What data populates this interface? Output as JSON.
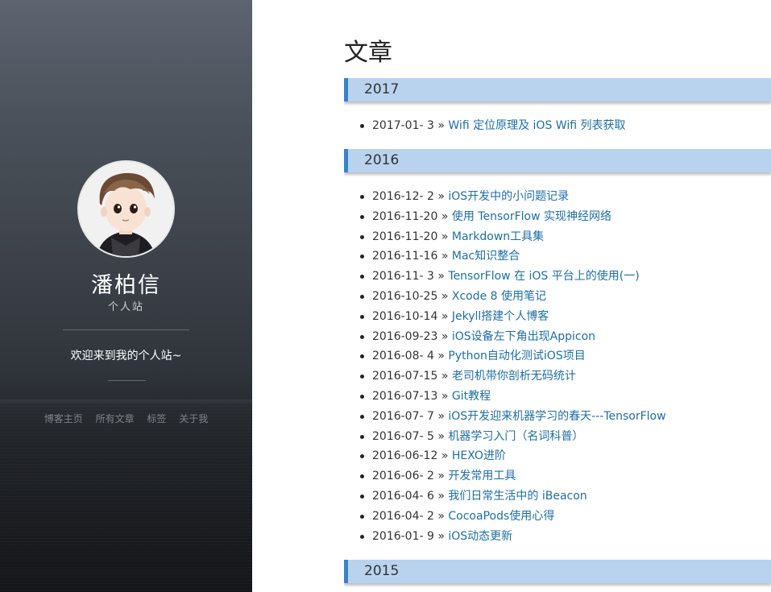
{
  "sidebar": {
    "name": "潘柏信",
    "subtitle": "个人站",
    "welcome": "欢迎来到我的个人站~",
    "nav": [
      "博客主页",
      "所有文章",
      "标签",
      "关于我"
    ]
  },
  "main": {
    "title": "文章",
    "separator": "»",
    "groups": [
      {
        "year": "2017",
        "posts": [
          {
            "date": "2017-01- 3",
            "title": "Wifi 定位原理及 iOS Wifi 列表获取"
          }
        ]
      },
      {
        "year": "2016",
        "posts": [
          {
            "date": "2016-12- 2",
            "title": "iOS开发中的小问题记录"
          },
          {
            "date": "2016-11-20",
            "title": "使用 TensorFlow 实现神经网络"
          },
          {
            "date": "2016-11-20",
            "title": "Markdown工具集"
          },
          {
            "date": "2016-11-16",
            "title": "Mac知识整合"
          },
          {
            "date": "2016-11- 3",
            "title": "TensorFlow 在 iOS 平台上的使用(一)"
          },
          {
            "date": "2016-10-25",
            "title": "Xcode 8 使用笔记"
          },
          {
            "date": "2016-10-14",
            "title": "Jekyll搭建个人博客"
          },
          {
            "date": "2016-09-23",
            "title": "iOS设备左下角出现Appicon"
          },
          {
            "date": "2016-08- 4",
            "title": "Python自动化测试iOS项目"
          },
          {
            "date": "2016-07-15",
            "title": "老司机带你剖析无码统计"
          },
          {
            "date": "2016-07-13",
            "title": "Git教程"
          },
          {
            "date": "2016-07- 7",
            "title": "iOS开发迎来机器学习的春天---TensorFlow"
          },
          {
            "date": "2016-07- 5",
            "title": "机器学习入门（名词科普）"
          },
          {
            "date": "2016-06-12",
            "title": "HEXO进阶"
          },
          {
            "date": "2016-06- 2",
            "title": "开发常用工具"
          },
          {
            "date": "2016-04- 6",
            "title": "我们日常生活中的 iBeacon"
          },
          {
            "date": "2016-04- 2",
            "title": "CocoaPods使用心得"
          },
          {
            "date": "2016-01- 9",
            "title": "iOS动态更新"
          }
        ]
      },
      {
        "year": "2015",
        "posts": []
      }
    ]
  }
}
